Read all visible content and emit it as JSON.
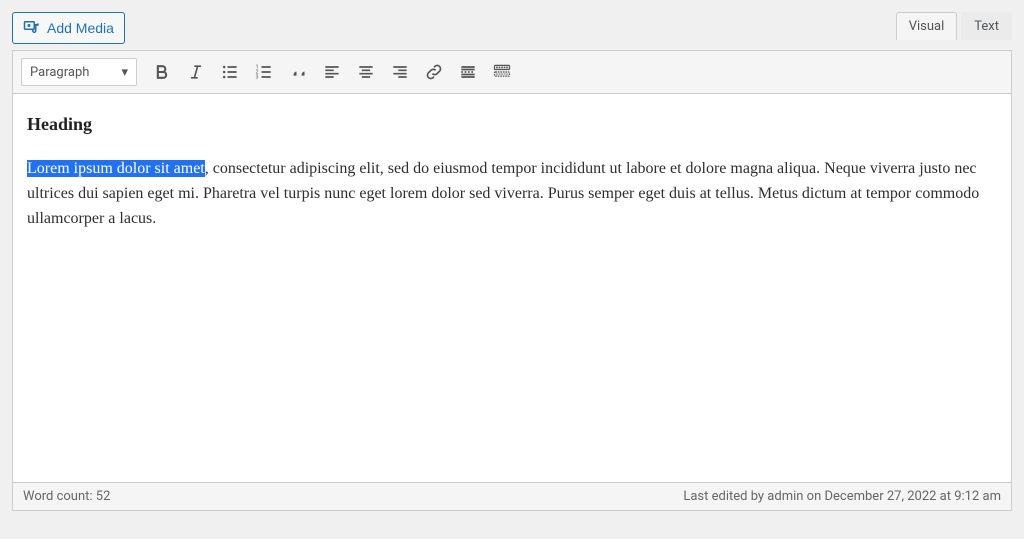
{
  "buttons": {
    "add_media": "Add Media"
  },
  "tabs": {
    "visual": "Visual",
    "text": "Text"
  },
  "toolbar": {
    "format_select": "Paragraph"
  },
  "content": {
    "heading": "Heading",
    "para_selected": "Lorem ipsum dolor sit amet",
    "para_rest": ", consectetur adipiscing elit, sed do eiusmod tempor incididunt ut labore et dolore magna aliqua. Neque viverra justo nec ultrices dui sapien eget mi. Pharetra vel turpis nunc eget lorem dolor sed viverra. Purus semper eget duis at tellus. Metus dictum at tempor commodo ullamcorper a lacus."
  },
  "status": {
    "word_count": "Word count: 52",
    "last_edited": "Last edited by admin on December 27, 2022 at 9:12 am"
  }
}
